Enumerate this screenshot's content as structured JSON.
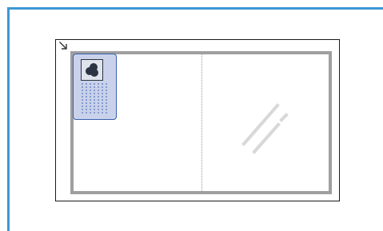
{
  "diagram": {
    "colors": {
      "accent": "#3c98d4",
      "glass_edge": "#9f9f9f",
      "document_fill": "#c9d2ea",
      "document_border": "#3a5fae",
      "text_lines": "#4263b4"
    },
    "icons": {
      "corner": "corner-arrow-icon",
      "picture": "picture-icon"
    }
  }
}
